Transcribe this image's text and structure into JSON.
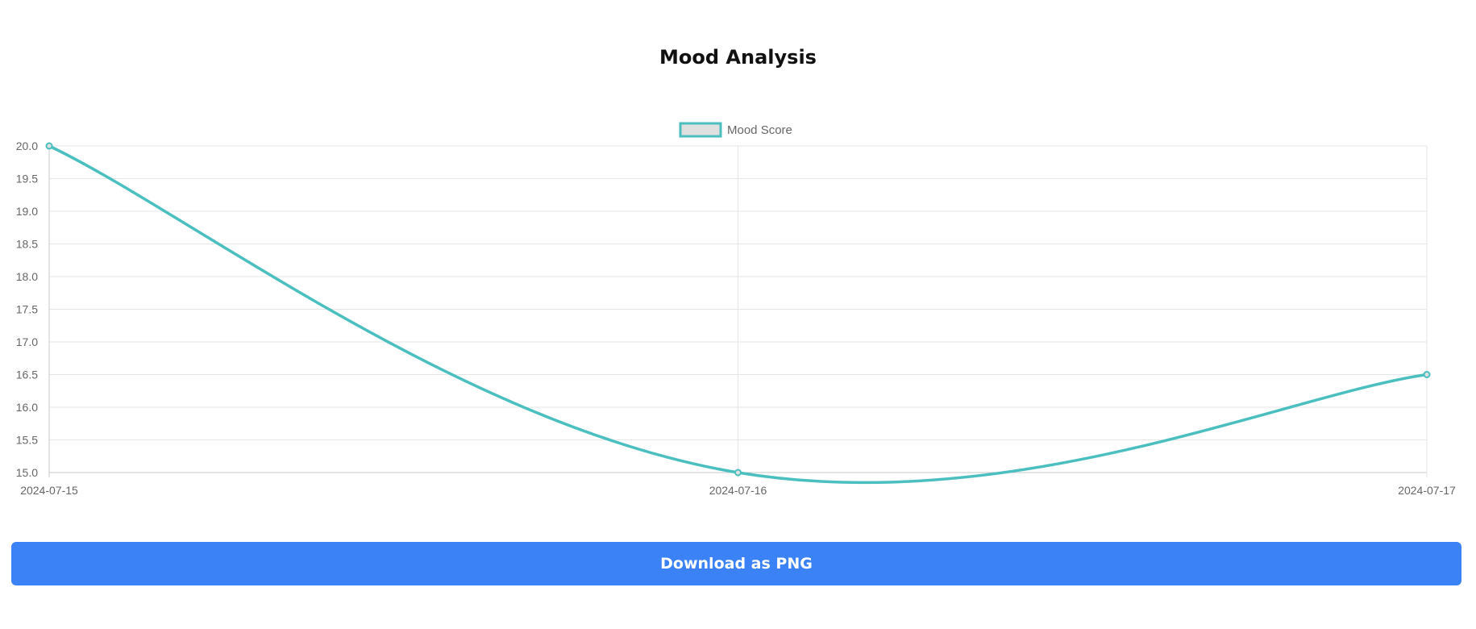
{
  "page": {
    "title": "Mood Analysis",
    "download_label": "Download as PNG"
  },
  "colors": {
    "line": "#4bbfbf",
    "legend_fill": "#e0e0e0",
    "grid": "#e5e5e5",
    "axis_text": "#666666",
    "button": "#3b82f6"
  },
  "chart_data": {
    "type": "line",
    "title": "Mood Analysis",
    "xlabel": "",
    "ylabel": "",
    "x": [
      "2024-07-15",
      "2024-07-16",
      "2024-07-17"
    ],
    "series": [
      {
        "name": "Mood Score",
        "values": [
          20.0,
          15.0,
          16.5
        ]
      }
    ],
    "ylim": [
      15.0,
      20.0
    ],
    "yticks": [
      "20.0",
      "19.5",
      "19.0",
      "18.5",
      "18.0",
      "17.5",
      "17.0",
      "16.5",
      "16.0",
      "15.5",
      "15.0"
    ],
    "grid": true,
    "legend_position": "top-center"
  }
}
